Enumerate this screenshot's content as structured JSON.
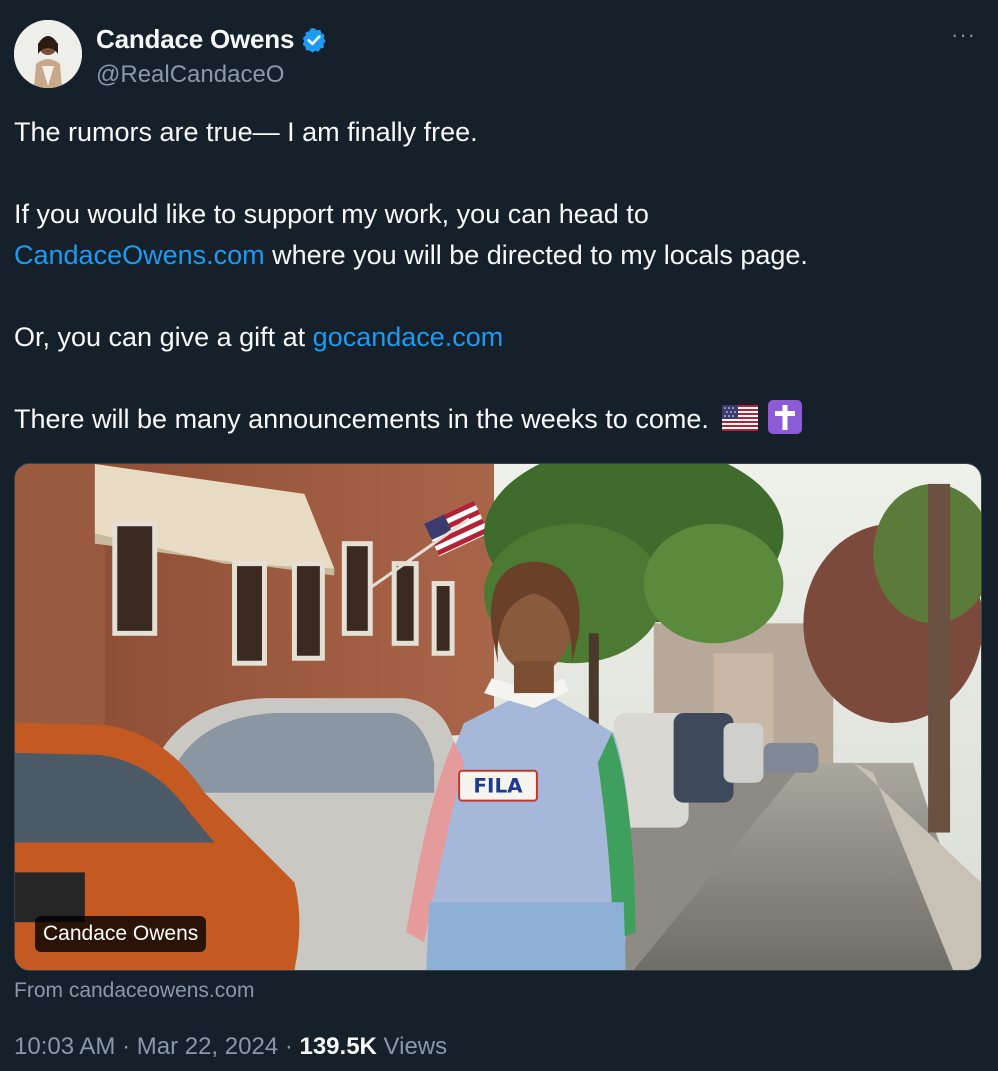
{
  "author": {
    "display_name": "Candace Owens",
    "handle": "@RealCandaceO",
    "verified_badge_icon": "verified-check-icon"
  },
  "menu": {
    "more_icon": "more-horizontal-icon",
    "more_glyph": "···"
  },
  "tweet": {
    "line1": "The rumors are true— I am finally free.",
    "line2_prefix": "If you would like to support my work, you can head to",
    "link1": "CandaceOwens.com",
    "line2_suffix": " where you will be directed to my locals page.",
    "line3_prefix": "Or, you can give a gift at ",
    "link2": "gocandace.com",
    "line4": "There will be many announcements in the weeks to come.",
    "emojis": [
      "us-flag-icon",
      "latin-cross-icon"
    ]
  },
  "media": {
    "caption": "Candace Owens",
    "shirt_logo": "FILA",
    "source": "From candaceowens.com"
  },
  "meta": {
    "time": "10:03 AM",
    "separator": " · ",
    "date": "Mar 22, 2024",
    "views_count": "139.5K",
    "views_label": " Views"
  },
  "colors": {
    "background": "#15202b",
    "text_primary": "#f7f9f9",
    "text_secondary": "#8b98a5",
    "link": "#1d9bf0",
    "verified": "#1d9bf0"
  }
}
